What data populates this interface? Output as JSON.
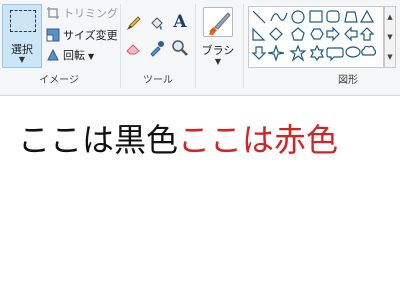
{
  "image_group": {
    "select_label": "選択",
    "crop_label": "トリミング",
    "resize_label": "サイズ変更",
    "rotate_label": "回転",
    "group_label": "イメージ"
  },
  "tools_group": {
    "text_tool_label": "A",
    "group_label": "ツール"
  },
  "brush_group": {
    "label": "ブラシ"
  },
  "shapes_group": {
    "group_label": "図形"
  },
  "canvas": {
    "text_black": "ここは黒色",
    "text_red": "ここは赤色",
    "color_black": "#111111",
    "color_red": "#d42323"
  },
  "colors": {
    "selected_bg": "#cde6f7",
    "selected_border": "#9ac4e6",
    "shape_stroke": "#1e5a8a"
  }
}
